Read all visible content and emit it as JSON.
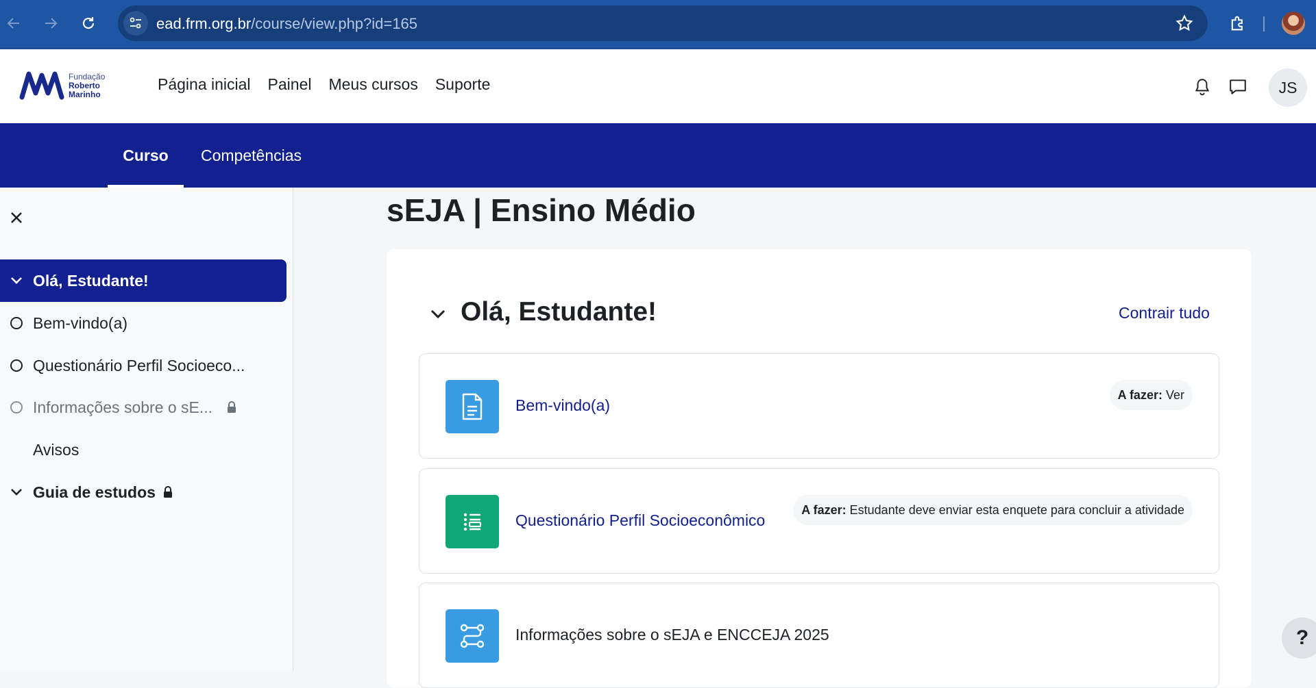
{
  "browser": {
    "url_domain": "ead.frm.org.br",
    "url_path": "/course/view.php?id=165"
  },
  "header": {
    "logo": {
      "line1": "Fundação",
      "line2": "Roberto",
      "line3": "Marinho"
    },
    "nav": [
      {
        "label": "Página inicial"
      },
      {
        "label": "Painel"
      },
      {
        "label": "Meus cursos"
      },
      {
        "label": "Suporte"
      }
    ],
    "user_initials": "JS"
  },
  "secondary_nav": {
    "tabs": [
      {
        "label": "Curso",
        "active": true
      },
      {
        "label": "Competências",
        "active": false
      }
    ]
  },
  "course_index": {
    "items": [
      {
        "label": "Olá, Estudante!",
        "type": "section",
        "active": true
      },
      {
        "label": "Bem-vindo(a)",
        "type": "activity"
      },
      {
        "label": "Questionário Perfil Socioeco...",
        "type": "activity"
      },
      {
        "label": "Informações sobre o sE...",
        "type": "activity",
        "locked": true
      },
      {
        "label": "Avisos",
        "type": "activity-noicon"
      },
      {
        "label": "Guia de estudos",
        "type": "section",
        "locked": true
      }
    ]
  },
  "main": {
    "course_title": "sEJA | Ensino Médio",
    "section_title": "Olá, Estudante!",
    "collapse_all": "Contrair tudo",
    "activities": [
      {
        "name": "Bem-vindo(a)",
        "icon": "page-icon",
        "icon_color": "#399be2",
        "todo_label": "A fazer:",
        "todo_value": "Ver"
      },
      {
        "name": "Questionário Perfil Socioeconômico",
        "icon": "feedback-icon",
        "icon_color": "#11a676",
        "todo_label": "A fazer:",
        "todo_value": "Estudante deve enviar esta enquete para concluir a atividade"
      },
      {
        "name": "Informações sobre o sEJA e ENCCEJA 2025",
        "icon": "lesson-icon",
        "icon_color": "#399be2"
      }
    ]
  },
  "help_label": "?",
  "colors": {
    "primary": "#13208f",
    "browser": "#1f56a4"
  }
}
